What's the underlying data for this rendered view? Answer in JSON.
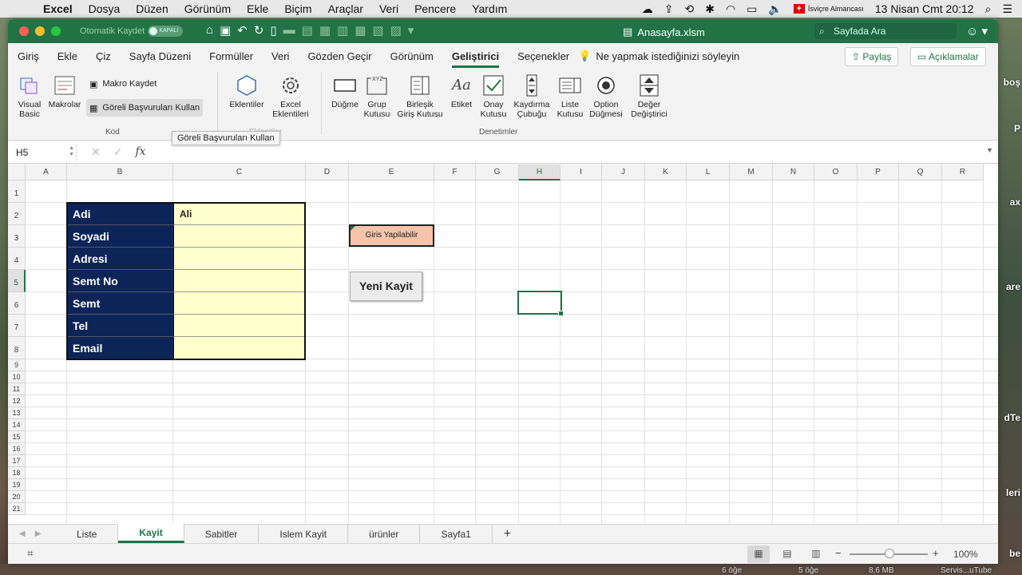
{
  "menubar": {
    "app": "Excel",
    "items": [
      "Dosya",
      "Düzen",
      "Görünüm",
      "Ekle",
      "Biçim",
      "Araçlar",
      "Veri",
      "Pencere",
      "Yardım"
    ],
    "input_source": "İsviçre Almancası",
    "datetime": "13 Nisan Cmt  20:12"
  },
  "titlebar": {
    "autosave_label": "Otomatik Kaydet",
    "autosave_state": "KAPALI",
    "doc_title": "Anasayfa.xlsm",
    "search_placeholder": "Sayfada Ara"
  },
  "ribbon_tabs": [
    "Giriş",
    "Ekle",
    "Çiz",
    "Sayfa Düzeni",
    "Formüller",
    "Veri",
    "Gözden Geçir",
    "Görünüm",
    "Geliştirici",
    "Seçenekler"
  ],
  "active_tab": "Geliştirici",
  "tell_me": "Ne yapmak istediğinizi söyleyin",
  "share_label": "Paylaş",
  "comments_label": "Açıklamalar",
  "ribbon": {
    "visual_basic": "Visual\nBasic",
    "macros": "Makrolar",
    "record_macro": "Makro Kaydet",
    "relative_refs": "Göreli Başvuruları Kullan",
    "group_code": "Kod",
    "addins": "Eklentiler",
    "excel_addins": "Excel\nEklentileri",
    "group_addins": "Eklentiler",
    "button": "Düğme",
    "group_box": "Grup\nKutusu",
    "combo_box": "Birleşik\nGiriş Kutusu",
    "label": "Etiket",
    "check_box": "Onay\nKutusu",
    "scroll_bar": "Kaydırma\nÇubuğu",
    "list_box": "Liste\nKutusu",
    "option_button": "Option\nDüğmesi",
    "spinner": "Değer\nDeğiştirici",
    "group_controls": "Denetimler",
    "tooltip": "Göreli Başvuruları Kullan"
  },
  "formula_bar": {
    "name_box": "H5",
    "formula": ""
  },
  "columns": [
    "A",
    "B",
    "C",
    "D",
    "E",
    "F",
    "G",
    "H",
    "I",
    "J",
    "K",
    "L",
    "M",
    "N",
    "O",
    "P",
    "Q",
    "R"
  ],
  "selected_column": "H",
  "rows": [
    "1",
    "2",
    "3",
    "4",
    "5",
    "6",
    "7",
    "8",
    "9",
    "10",
    "11",
    "12",
    "13",
    "14",
    "15",
    "16",
    "17",
    "18",
    "19",
    "20",
    "21"
  ],
  "selected_row": "5",
  "form": {
    "labels": [
      "Adi",
      "Soyadi",
      "Adresi",
      "Semt No",
      "Semt",
      "Tel",
      "Email"
    ],
    "values": [
      "Ali",
      "",
      "",
      "",
      "",
      "",
      ""
    ]
  },
  "giris_label": "Giris Yapilabilir",
  "yeni_kayit_label": "Yeni Kayit",
  "sheets": [
    "Liste",
    "Kayit",
    "Sabitler",
    "Islem Kayit",
    "ürünler",
    "Sayfa1"
  ],
  "active_sheet": "Kayit",
  "zoom": "100%",
  "desktop_labels": {
    "boş": "boş",
    "P": "P",
    "ax": "ax",
    "are": "are",
    "dTe": "dTe",
    "leri": "leri",
    "be": "be",
    "oge1": "6 öğe",
    "oge2": "5 öğe",
    "mb": "8,6 MB",
    "servis": "Servis...uTube"
  },
  "colors": {
    "excel_green": "#217346",
    "form_label_bg": "#0d2458",
    "form_value_bg": "#ffffcc",
    "giris_bg": "#f6c4a8"
  }
}
